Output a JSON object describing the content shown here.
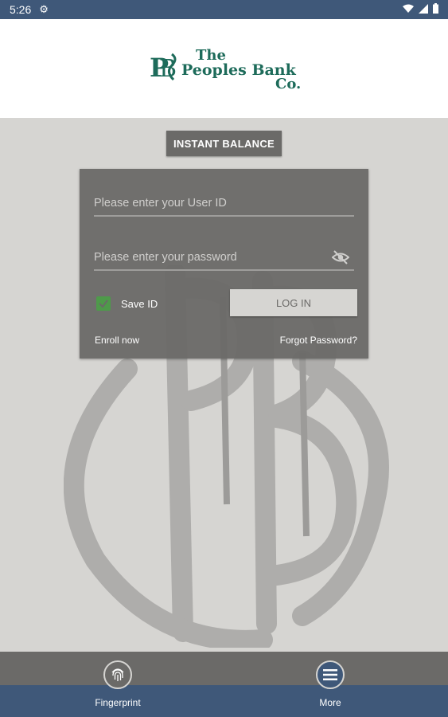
{
  "status_bar": {
    "time": "5:26",
    "icons": [
      "gear-icon",
      "wifi-icon",
      "signal-icon",
      "battery-icon"
    ]
  },
  "logo": {
    "monogram": "PBS",
    "line1": "The",
    "line2": "Peoples Bank",
    "line3": "Co.",
    "color": "#1d6b5a"
  },
  "instant_balance_label": "INSTANT BALANCE",
  "login": {
    "user_placeholder": "Please enter your User ID",
    "password_placeholder": "Please enter your password",
    "save_id_label": "Save ID",
    "save_id_checked": true,
    "login_label": "LOG IN",
    "enroll_label": "Enroll now",
    "forgot_label": "Forgot Password?"
  },
  "nav": {
    "fingerprint_label": "Fingerprint",
    "more_label": "More"
  },
  "colors": {
    "status_bar": "#3f5879",
    "card": "#6b6a68",
    "background": "#d6d5d2",
    "checkbox": "#4e9a4a"
  }
}
